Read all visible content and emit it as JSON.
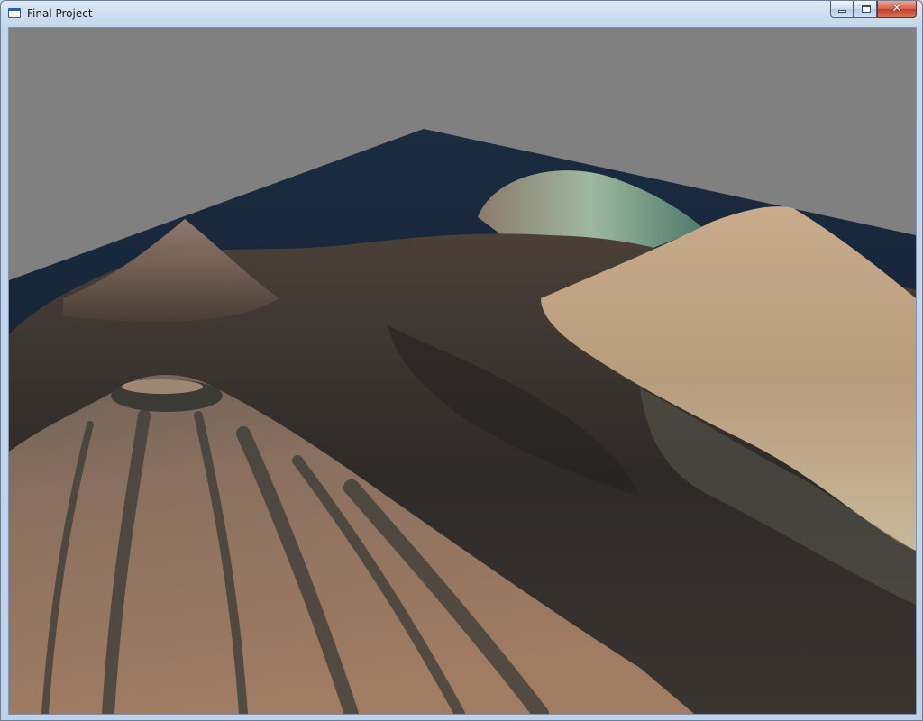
{
  "window": {
    "title": "Final Project",
    "app_icon": "window-app-icon",
    "controls": {
      "minimize_icon": "minimize-icon",
      "maximize_icon": "maximize-icon",
      "close_icon": "close-icon",
      "close_glyph": "✕"
    }
  },
  "scene": {
    "background_color": "#808080",
    "plane_color": "#14243a",
    "terrain_colors": [
      "#3a3430",
      "#5a4a40",
      "#8a7060",
      "#b09070",
      "#c8b89a",
      "#2e2a28"
    ]
  }
}
